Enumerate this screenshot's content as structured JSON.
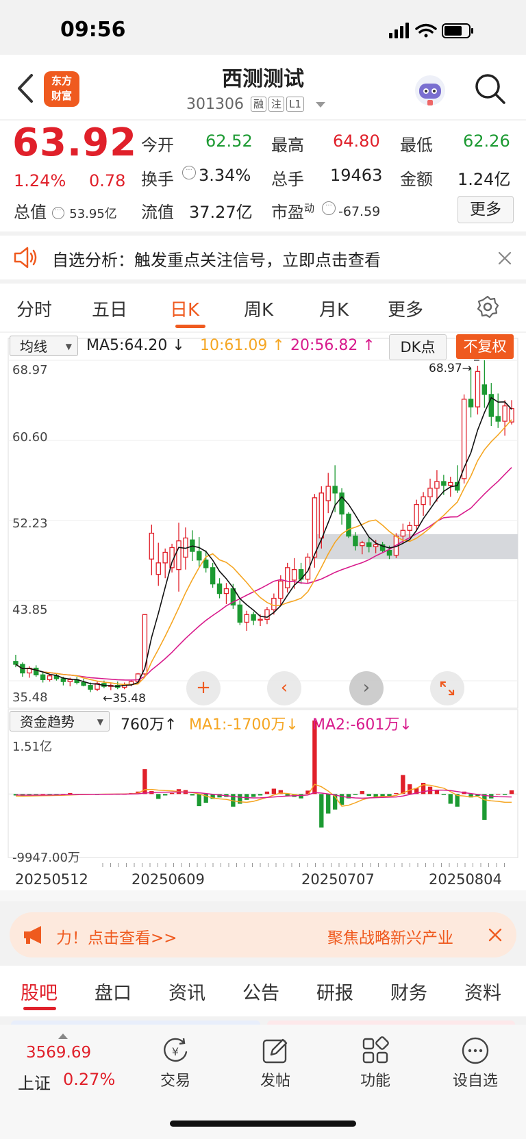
{
  "status": {
    "time": "09:56"
  },
  "header": {
    "logo_line1": "东方",
    "logo_line2": "财富",
    "stock_name": "西测测试",
    "stock_code": "301306",
    "tags": [
      "融",
      "注",
      "L1"
    ]
  },
  "quote": {
    "price": "63.92",
    "change_pct": "1.24%",
    "change": "0.78",
    "total_value_label": "总值",
    "total_value": "53.95亿",
    "open_label": "今开",
    "open": "62.52",
    "high_label": "最高",
    "high": "64.80",
    "low_label": "最低",
    "low": "62.26",
    "turnover_label": "换手",
    "turnover": "3.34%",
    "volume_label": "总手",
    "volume": "19463",
    "amount_label": "金额",
    "amount": "1.24亿",
    "float_label": "流值",
    "float_value": "37.27亿",
    "pe_label": "市盈",
    "pe_sup": "动",
    "pe": "-67.59",
    "more_label": "更多"
  },
  "notice": {
    "text": "自选分析：触发重点关注信号，立即点击查看"
  },
  "ktabs": [
    "分时",
    "五日",
    "日K",
    "周K",
    "月K",
    "更多"
  ],
  "chart_header": {
    "indicator": "均线",
    "ma5": "MA5:64.20",
    "ma10": "10:61.09",
    "ma20": "20:56.82",
    "dk": "DK点",
    "fq": "不复权"
  },
  "flow_header": {
    "indicator": "资金趋势",
    "value": "760万",
    "ma1": "MA1:-1700万",
    "ma2": "MA2:-601万"
  },
  "colors": {
    "up": "#e0202a",
    "down": "#1c9a32",
    "ma5": "#111111",
    "ma10": "#f5a623",
    "ma20": "#d81b8c",
    "accent": "#ef5a1f"
  },
  "chart_data": [
    {
      "type": "candlestick",
      "y_ticks": [
        "68.97",
        "60.60",
        "52.23",
        "43.85",
        "35.48"
      ],
      "ylim": [
        35.48,
        68.97
      ],
      "max_label": "68.97",
      "min_label": "35.48",
      "x_dates": [
        "20250512",
        "20250609",
        "20250707",
        "20250804"
      ],
      "candles": [
        [
          37.5,
          38.2,
          36.9,
          37.2
        ],
        [
          37.2,
          37.4,
          35.9,
          36.3
        ],
        [
          36.3,
          37.0,
          35.8,
          36.8
        ],
        [
          36.8,
          37.1,
          35.9,
          36.1
        ],
        [
          36.1,
          36.4,
          35.3,
          35.6
        ],
        [
          35.6,
          36.2,
          35.4,
          36.0
        ],
        [
          36.0,
          36.3,
          35.5,
          35.7
        ],
        [
          35.7,
          35.9,
          35.0,
          35.4
        ],
        [
          35.4,
          35.8,
          34.9,
          35.6
        ],
        [
          35.6,
          35.9,
          35.1,
          35.3
        ],
        [
          35.3,
          35.7,
          34.9,
          35.0
        ],
        [
          35.0,
          35.3,
          34.3,
          34.6
        ],
        [
          34.6,
          35.4,
          34.4,
          35.2
        ],
        [
          35.2,
          35.5,
          34.7,
          34.9
        ],
        [
          34.9,
          35.2,
          34.5,
          35.0
        ],
        [
          35.0,
          35.4,
          34.6,
          34.8
        ],
        [
          34.8,
          35.3,
          34.6,
          35.1
        ],
        [
          35.1,
          35.6,
          34.9,
          35.4
        ],
        [
          35.4,
          36.3,
          35.1,
          36.2
        ],
        [
          36.2,
          42.4,
          36.0,
          42.4
        ],
        [
          48.2,
          51.8,
          46.5,
          50.9
        ],
        [
          46.6,
          49.9,
          45.4,
          47.8
        ],
        [
          47.8,
          49.3,
          46.2,
          48.9
        ],
        [
          47.3,
          49.8,
          46.8,
          49.4
        ],
        [
          47.1,
          52.0,
          44.8,
          50.1
        ],
        [
          48.4,
          51.5,
          47.1,
          50.4
        ],
        [
          50.2,
          51.2,
          48.0,
          49.0
        ],
        [
          49.0,
          50.5,
          47.4,
          48.1
        ],
        [
          48.1,
          49.1,
          46.8,
          47.3
        ],
        [
          47.3,
          47.8,
          45.2,
          45.6
        ],
        [
          45.6,
          46.2,
          44.1,
          44.6
        ],
        [
          44.6,
          45.7,
          43.5,
          45.1
        ],
        [
          45.1,
          45.6,
          43.0,
          43.4
        ],
        [
          43.4,
          43.9,
          41.3,
          41.6
        ],
        [
          41.6,
          42.8,
          40.7,
          42.4
        ],
        [
          42.4,
          42.7,
          41.3,
          41.8
        ],
        [
          41.8,
          42.4,
          41.2,
          41.9
        ],
        [
          41.9,
          43.2,
          41.4,
          42.9
        ],
        [
          42.9,
          44.6,
          42.4,
          44.1
        ],
        [
          44.1,
          46.5,
          43.3,
          45.9
        ],
        [
          45.2,
          47.8,
          44.7,
          47.3
        ],
        [
          46.0,
          48.3,
          45.1,
          47.1
        ],
        [
          47.1,
          47.8,
          45.6,
          46.1
        ],
        [
          46.1,
          48.8,
          45.7,
          48.4
        ],
        [
          48.4,
          55.0,
          47.3,
          54.6
        ],
        [
          50.4,
          55.8,
          49.3,
          55.1
        ],
        [
          54.3,
          57.2,
          53.0,
          55.8
        ],
        [
          55.8,
          58.0,
          53.1,
          55.1
        ],
        [
          55.1,
          55.6,
          51.8,
          52.9
        ],
        [
          52.9,
          53.1,
          50.4,
          50.6
        ],
        [
          50.6,
          51.0,
          49.1,
          49.6
        ],
        [
          49.6,
          50.1,
          48.7,
          49.9
        ],
        [
          49.9,
          50.4,
          48.9,
          49.5
        ],
        [
          49.5,
          50.2,
          48.8,
          49.7
        ],
        [
          49.7,
          50.0,
          48.9,
          49.1
        ],
        [
          49.1,
          49.6,
          48.2,
          48.6
        ],
        [
          48.6,
          50.9,
          48.3,
          50.6
        ],
        [
          50.6,
          51.9,
          49.8,
          51.2
        ],
        [
          51.2,
          52.1,
          50.4,
          51.7
        ],
        [
          51.7,
          54.4,
          51.1,
          53.9
        ],
        [
          53.9,
          55.2,
          52.7,
          54.7
        ],
        [
          54.7,
          56.6,
          53.8,
          55.6
        ],
        [
          55.6,
          57.5,
          54.2,
          56.3
        ],
        [
          56.3,
          57.0,
          54.9,
          55.9
        ],
        [
          55.9,
          56.8,
          54.7,
          56.2
        ],
        [
          56.2,
          58.0,
          55.1,
          55.4
        ],
        [
          56.6,
          65.4,
          56.1,
          64.9
        ],
        [
          64.9,
          68.1,
          63.0,
          64.1
        ],
        [
          64.1,
          68.4,
          63.3,
          67.8
        ],
        [
          66.4,
          68.97,
          64.0,
          65.4
        ],
        [
          65.4,
          66.6,
          62.1,
          63.1
        ],
        [
          63.1,
          65.5,
          61.9,
          62.6
        ],
        [
          62.6,
          64.8,
          61.1,
          64.2
        ],
        [
          62.52,
          64.8,
          62.26,
          63.92
        ]
      ],
      "zone_band": [
        48.2,
        50.8
      ]
    },
    {
      "type": "bar",
      "title": "资金趋势",
      "y_ticks": [
        "1.51亿",
        "-9947.00万"
      ],
      "ylim": [
        -9947,
        15100
      ],
      "values": [
        -300,
        -500,
        -200,
        -100,
        0,
        -100,
        -200,
        0,
        200,
        -100,
        -100,
        0,
        -200,
        -100,
        0,
        -100,
        0,
        200,
        500,
        5100,
        600,
        -1000,
        -300,
        200,
        1000,
        800,
        -300,
        -2500,
        -1800,
        -1000,
        -700,
        -600,
        -2600,
        -2000,
        -1200,
        -600,
        -300,
        500,
        1100,
        800,
        -400,
        -600,
        -900,
        700,
        15100,
        -6900,
        -4000,
        -3200,
        -2200,
        -900,
        -200,
        600,
        -400,
        -800,
        -700,
        -400,
        200,
        3900,
        2000,
        1200,
        2300,
        1500,
        800,
        -200,
        -2000,
        -2600,
        500,
        -700,
        -400,
        -5300,
        -900,
        0,
        -200,
        760
      ],
      "ma1": [
        -400,
        -450,
        -420,
        -380,
        -350,
        -320,
        -300,
        -250,
        -200,
        -150,
        -100,
        -80,
        -50,
        -30,
        -20,
        -10,
        0,
        50,
        150,
        900,
        950,
        800,
        700,
        650,
        500,
        400,
        300,
        0,
        -400,
        -800,
        -1000,
        -1100,
        -1400,
        -1600,
        -1700,
        -1500,
        -1100,
        -700,
        -200,
        200,
        100,
        -100,
        -300,
        -200,
        2000,
        1500,
        600,
        -500,
        -2500,
        -2300,
        -1800,
        -1200,
        -800,
        -600,
        -500,
        -500,
        -300,
        200,
        800,
        1200,
        1900,
        1800,
        1500,
        1200,
        500,
        -300,
        -400,
        -600,
        -500,
        -1200,
        -1400,
        -1500,
        -1700,
        -1700
      ],
      "ma2": [
        -200,
        -220,
        -240,
        -230,
        -220,
        -200,
        -180,
        -150,
        -120,
        -100,
        -80,
        -70,
        -60,
        -50,
        -40,
        -30,
        -20,
        0,
        50,
        200,
        300,
        350,
        380,
        400,
        420,
        400,
        350,
        250,
        100,
        -50,
        -200,
        -350,
        -500,
        -650,
        -750,
        -800,
        -780,
        -700,
        -600,
        -500,
        -400,
        -350,
        -300,
        -200,
        300,
        200,
        0,
        -200,
        -500,
        -700,
        -800,
        -850,
        -800,
        -750,
        -700,
        -650,
        -600,
        -400,
        -100,
        200,
        500,
        700,
        800,
        800,
        700,
        500,
        300,
        100,
        -100,
        -300,
        -450,
        -550,
        -580,
        -601
      ]
    }
  ],
  "chart_buttons": [
    "+",
    "‹",
    "›"
  ],
  "ad": {
    "left": "力！点击查看>>",
    "right": "聚焦战略新兴产业"
  },
  "btabs": [
    "股吧",
    "盘口",
    "资讯",
    "公告",
    "研报",
    "财务",
    "资料"
  ],
  "bottom_nav": {
    "index_value": "3569.69",
    "index_name": "上证",
    "index_pct": "0.27%",
    "items": [
      "交易",
      "发帖",
      "功能",
      "设自选"
    ]
  }
}
